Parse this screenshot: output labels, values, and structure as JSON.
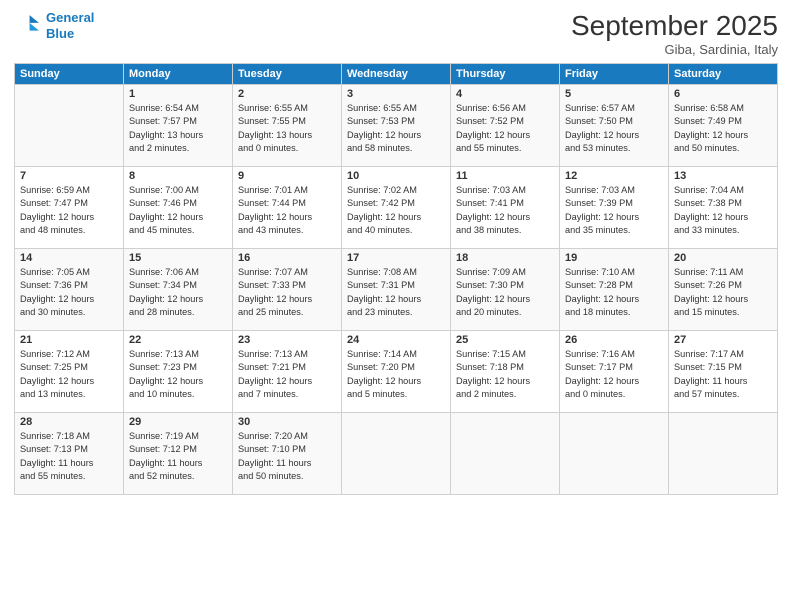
{
  "logo": {
    "line1": "General",
    "line2": "Blue"
  },
  "title": "September 2025",
  "subtitle": "Giba, Sardinia, Italy",
  "days_header": [
    "Sunday",
    "Monday",
    "Tuesday",
    "Wednesday",
    "Thursday",
    "Friday",
    "Saturday"
  ],
  "weeks": [
    [
      {
        "day": "",
        "info": ""
      },
      {
        "day": "1",
        "info": "Sunrise: 6:54 AM\nSunset: 7:57 PM\nDaylight: 13 hours\nand 2 minutes."
      },
      {
        "day": "2",
        "info": "Sunrise: 6:55 AM\nSunset: 7:55 PM\nDaylight: 13 hours\nand 0 minutes."
      },
      {
        "day": "3",
        "info": "Sunrise: 6:55 AM\nSunset: 7:53 PM\nDaylight: 12 hours\nand 58 minutes."
      },
      {
        "day": "4",
        "info": "Sunrise: 6:56 AM\nSunset: 7:52 PM\nDaylight: 12 hours\nand 55 minutes."
      },
      {
        "day": "5",
        "info": "Sunrise: 6:57 AM\nSunset: 7:50 PM\nDaylight: 12 hours\nand 53 minutes."
      },
      {
        "day": "6",
        "info": "Sunrise: 6:58 AM\nSunset: 7:49 PM\nDaylight: 12 hours\nand 50 minutes."
      }
    ],
    [
      {
        "day": "7",
        "info": "Sunrise: 6:59 AM\nSunset: 7:47 PM\nDaylight: 12 hours\nand 48 minutes."
      },
      {
        "day": "8",
        "info": "Sunrise: 7:00 AM\nSunset: 7:46 PM\nDaylight: 12 hours\nand 45 minutes."
      },
      {
        "day": "9",
        "info": "Sunrise: 7:01 AM\nSunset: 7:44 PM\nDaylight: 12 hours\nand 43 minutes."
      },
      {
        "day": "10",
        "info": "Sunrise: 7:02 AM\nSunset: 7:42 PM\nDaylight: 12 hours\nand 40 minutes."
      },
      {
        "day": "11",
        "info": "Sunrise: 7:03 AM\nSunset: 7:41 PM\nDaylight: 12 hours\nand 38 minutes."
      },
      {
        "day": "12",
        "info": "Sunrise: 7:03 AM\nSunset: 7:39 PM\nDaylight: 12 hours\nand 35 minutes."
      },
      {
        "day": "13",
        "info": "Sunrise: 7:04 AM\nSunset: 7:38 PM\nDaylight: 12 hours\nand 33 minutes."
      }
    ],
    [
      {
        "day": "14",
        "info": "Sunrise: 7:05 AM\nSunset: 7:36 PM\nDaylight: 12 hours\nand 30 minutes."
      },
      {
        "day": "15",
        "info": "Sunrise: 7:06 AM\nSunset: 7:34 PM\nDaylight: 12 hours\nand 28 minutes."
      },
      {
        "day": "16",
        "info": "Sunrise: 7:07 AM\nSunset: 7:33 PM\nDaylight: 12 hours\nand 25 minutes."
      },
      {
        "day": "17",
        "info": "Sunrise: 7:08 AM\nSunset: 7:31 PM\nDaylight: 12 hours\nand 23 minutes."
      },
      {
        "day": "18",
        "info": "Sunrise: 7:09 AM\nSunset: 7:30 PM\nDaylight: 12 hours\nand 20 minutes."
      },
      {
        "day": "19",
        "info": "Sunrise: 7:10 AM\nSunset: 7:28 PM\nDaylight: 12 hours\nand 18 minutes."
      },
      {
        "day": "20",
        "info": "Sunrise: 7:11 AM\nSunset: 7:26 PM\nDaylight: 12 hours\nand 15 minutes."
      }
    ],
    [
      {
        "day": "21",
        "info": "Sunrise: 7:12 AM\nSunset: 7:25 PM\nDaylight: 12 hours\nand 13 minutes."
      },
      {
        "day": "22",
        "info": "Sunrise: 7:13 AM\nSunset: 7:23 PM\nDaylight: 12 hours\nand 10 minutes."
      },
      {
        "day": "23",
        "info": "Sunrise: 7:13 AM\nSunset: 7:21 PM\nDaylight: 12 hours\nand 7 minutes."
      },
      {
        "day": "24",
        "info": "Sunrise: 7:14 AM\nSunset: 7:20 PM\nDaylight: 12 hours\nand 5 minutes."
      },
      {
        "day": "25",
        "info": "Sunrise: 7:15 AM\nSunset: 7:18 PM\nDaylight: 12 hours\nand 2 minutes."
      },
      {
        "day": "26",
        "info": "Sunrise: 7:16 AM\nSunset: 7:17 PM\nDaylight: 12 hours\nand 0 minutes."
      },
      {
        "day": "27",
        "info": "Sunrise: 7:17 AM\nSunset: 7:15 PM\nDaylight: 11 hours\nand 57 minutes."
      }
    ],
    [
      {
        "day": "28",
        "info": "Sunrise: 7:18 AM\nSunset: 7:13 PM\nDaylight: 11 hours\nand 55 minutes."
      },
      {
        "day": "29",
        "info": "Sunrise: 7:19 AM\nSunset: 7:12 PM\nDaylight: 11 hours\nand 52 minutes."
      },
      {
        "day": "30",
        "info": "Sunrise: 7:20 AM\nSunset: 7:10 PM\nDaylight: 11 hours\nand 50 minutes."
      },
      {
        "day": "",
        "info": ""
      },
      {
        "day": "",
        "info": ""
      },
      {
        "day": "",
        "info": ""
      },
      {
        "day": "",
        "info": ""
      }
    ]
  ]
}
